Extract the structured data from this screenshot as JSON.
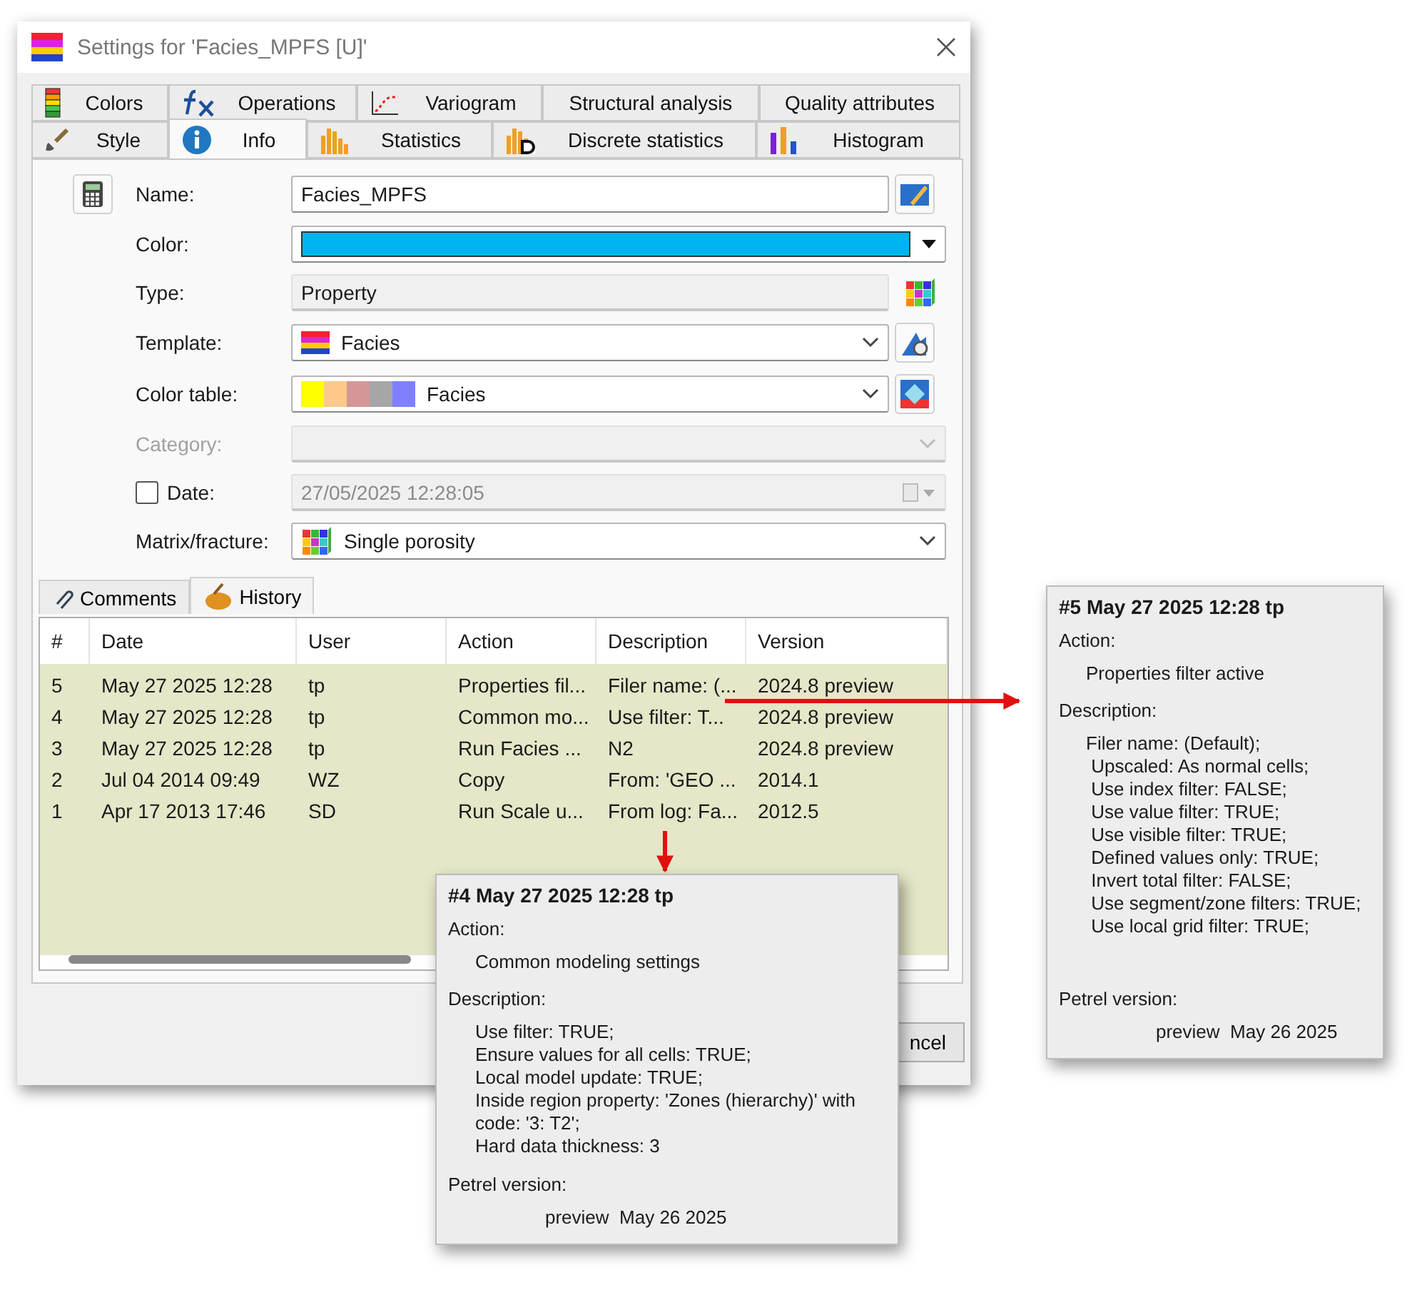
{
  "window": {
    "title": "Settings for 'Facies_MPFS [U]'"
  },
  "tab_rows": [
    [
      {
        "label": "Colors",
        "selected": false
      },
      {
        "label": "Operations",
        "selected": false
      },
      {
        "label": "Variogram",
        "selected": false
      },
      {
        "label": "Structural analysis",
        "selected": false
      },
      {
        "label": "Quality attributes",
        "selected": false
      }
    ],
    [
      {
        "label": "Style",
        "selected": false
      },
      {
        "label": "Info",
        "selected": true
      },
      {
        "label": "Statistics",
        "selected": false
      },
      {
        "label": "Discrete statistics",
        "selected": false
      },
      {
        "label": "Histogram",
        "selected": false
      }
    ]
  ],
  "form": {
    "fields": [
      {
        "kind": "text",
        "label": "Name:",
        "value": "Facies_MPFS"
      },
      {
        "kind": "color",
        "label": "Color:",
        "color": "#00b4f0"
      },
      {
        "kind": "readonly",
        "label": "Type:",
        "value": "Property"
      },
      {
        "kind": "select",
        "label": "Template:",
        "value": "Facies"
      },
      {
        "kind": "colortable",
        "label": "Color table:",
        "value": "Facies"
      },
      {
        "kind": "select",
        "label": "Category:",
        "disabled": true
      },
      {
        "kind": "date",
        "label": "Date:",
        "value": "27/05/2025 12:28:05",
        "checked": false,
        "disabled": true
      },
      {
        "kind": "select",
        "label": "Matrix/fracture:",
        "value": "Single porosity"
      }
    ]
  },
  "subtabs": [
    {
      "label": "Comments",
      "selected": false
    },
    {
      "label": "History",
      "selected": true
    }
  ],
  "history_table": {
    "columns": [
      "#",
      "Date",
      "User",
      "Action",
      "Description",
      "Version"
    ],
    "rows": [
      [
        "5",
        "May 27 2025 12:28",
        "tp",
        "Properties fil...",
        "Filer name: (...",
        "2024.8 preview"
      ],
      [
        "4",
        "May 27 2025 12:28",
        "tp",
        "Common mo...",
        "Use filter: T...",
        "2024.8 preview"
      ],
      [
        "3",
        "May 27 2025 12:28",
        "tp",
        "Run Facies ...",
        "N2",
        "2024.8 preview"
      ],
      [
        "2",
        "Jul 04 2014 09:49",
        "WZ",
        "Copy",
        "From: 'GEO ...",
        "2014.1"
      ],
      [
        "1",
        "Apr 17 2013 17:46",
        "SD",
        "Run Scale u...",
        "From log: Fa...",
        "2012.5"
      ]
    ]
  },
  "buttons": [
    {
      "label": "ncel"
    }
  ],
  "tooltips": [
    {
      "title": "#4  May 27 2025 12:28  tp",
      "action_label": "Action:",
      "action": "Common modeling settings",
      "description_label": "Description:",
      "description_lines": [
        "Use filter: TRUE;",
        "Ensure values for all cells: TRUE;",
        "Local model update: TRUE;",
        "Inside region property: 'Zones (hierarchy)' with code: '3: T2';",
        "Hard data thickness: 3"
      ],
      "version_label": "Petrel version:",
      "version": "preview  May 26 2025"
    },
    {
      "title": "#5  May 27 2025 12:28  tp",
      "action_label": "Action:",
      "action": "Properties filter active",
      "description_label": "Description:",
      "description_lines": [
        "Filer name: (Default);",
        " Upscaled: As normal cells;",
        " Use index filter: FALSE;",
        " Use value filter: TRUE;",
        " Use visible filter: TRUE;",
        " Defined values only: TRUE;",
        " Invert total filter: FALSE;",
        " Use segment/zone filters: TRUE;",
        " Use local grid filter: TRUE;"
      ],
      "version_label": "Petrel version:",
      "version": "preview  May 26 2025"
    }
  ]
}
